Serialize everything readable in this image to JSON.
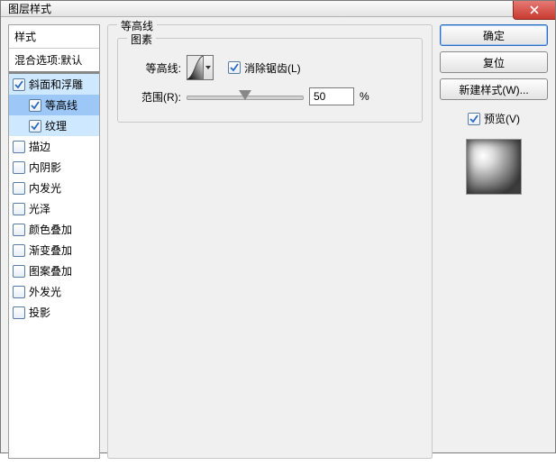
{
  "window": {
    "title": "图层样式"
  },
  "styles_panel": {
    "header_styles": "样式",
    "header_blend": "混合选项:默认",
    "items": [
      {
        "label": "斜面和浮雕",
        "checked": true,
        "selected": "light"
      },
      {
        "label": "等高线",
        "checked": true,
        "selected": "dark",
        "child": true
      },
      {
        "label": "纹理",
        "checked": true,
        "selected": "light",
        "child": true
      },
      {
        "label": "描边",
        "checked": false
      },
      {
        "label": "内阴影",
        "checked": false
      },
      {
        "label": "内发光",
        "checked": false
      },
      {
        "label": "光泽",
        "checked": false
      },
      {
        "label": "颜色叠加",
        "checked": false
      },
      {
        "label": "渐变叠加",
        "checked": false
      },
      {
        "label": "图案叠加",
        "checked": false
      },
      {
        "label": "外发光",
        "checked": false
      },
      {
        "label": "投影",
        "checked": false
      }
    ]
  },
  "center": {
    "outer_group": "等高线",
    "inner_group": "图素",
    "contour_label": "等高线:",
    "antialias_label": "消除锯齿(L)",
    "antialias_checked": true,
    "range_label": "范围(R):",
    "range_value": "50",
    "range_pct": 50,
    "range_unit": "%"
  },
  "right": {
    "ok": "确定",
    "reset": "复位",
    "new_style": "新建样式(W)...",
    "preview_label": "预览(V)",
    "preview_checked": true
  }
}
